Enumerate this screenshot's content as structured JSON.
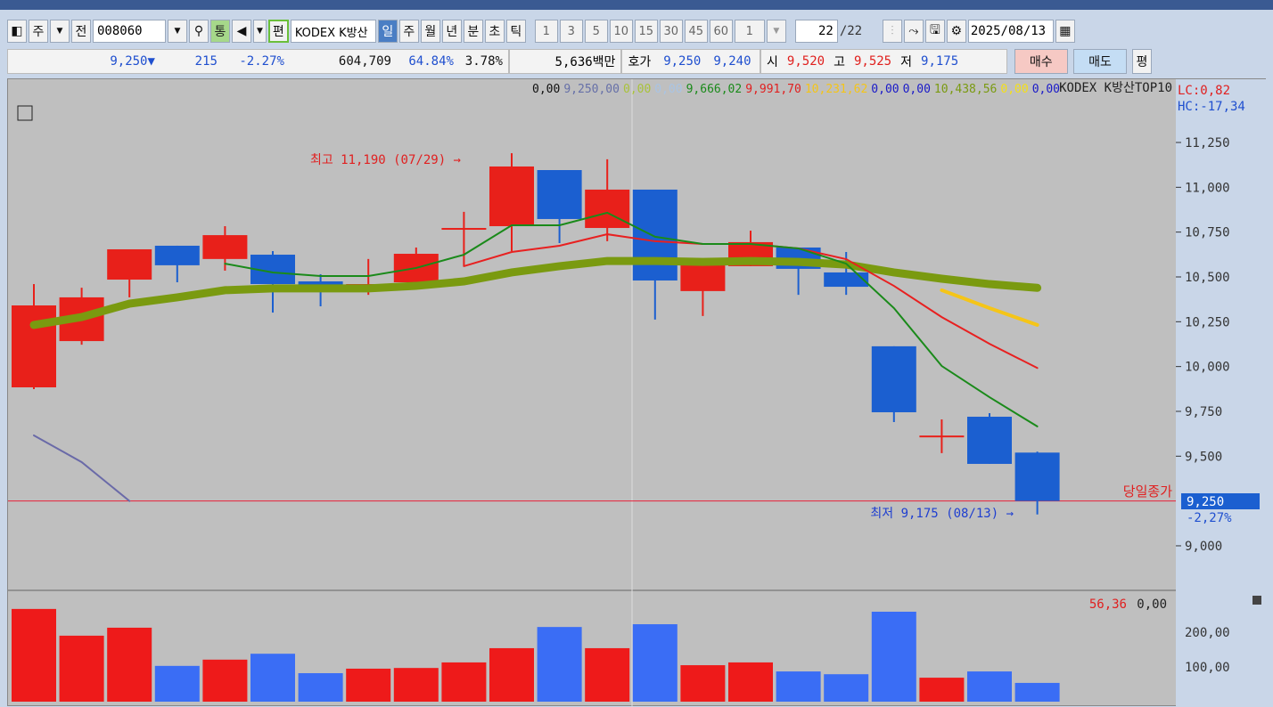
{
  "toolbar": {
    "market": "주",
    "prev": "전",
    "code": "008060",
    "tong": "통",
    "pyeon": "편",
    "name": "KODEX K방산",
    "periods": [
      "일",
      "주",
      "월",
      "년",
      "분",
      "초",
      "틱"
    ],
    "active_period": "일",
    "intervals": [
      "1",
      "3",
      "5",
      "10",
      "15",
      "30",
      "45",
      "60"
    ],
    "count_select": "1",
    "count": "22",
    "total": "/22",
    "date": "2025/08/13"
  },
  "info": {
    "price": "9,250",
    "arrow": "▼",
    "change": "215",
    "change_pct": "-2.27%",
    "volume": "604,709",
    "vol_ratio": "64.84%",
    "turnover": "3.78%",
    "amount": "5,636백만",
    "hoga_label": "호가",
    "ask": "9,250",
    "bid": "9,240",
    "open_label": "시",
    "open": "9,520",
    "high_label": "고",
    "high": "9,525",
    "low_label": "저",
    "low": "9,175",
    "buy": "매수",
    "sell": "매도",
    "avg": "평"
  },
  "legend": {
    "v1": "0,00",
    "v2": "9,250,00",
    "v3": "0,00",
    "v4": "0,00",
    "v5": "9,666,02",
    "v6": "9,991,70",
    "v7": "10,231,62",
    "v8": "0,00",
    "v9": "0,00",
    "v10": "10,438,56",
    "v11": "0,00",
    "v12": "0,00",
    "title": "KODEX K방산TOP10",
    "lc": "LC:0,82",
    "hc": "HC:-17,34"
  },
  "annotations": {
    "high": "최고 11,190 (07/29) →",
    "low": "최저 9,175 (08/13) →",
    "close_label": "당일종가",
    "cur_price": "9,250",
    "cur_pct": "-2,27%"
  },
  "volume_legend": {
    "v1": "56,36",
    "v2": "0,00"
  },
  "colors": {
    "up": "#e8201a",
    "down": "#1b5fd0",
    "ma5": "#1a8a1a",
    "ma10": "#e82020",
    "ma20": "#f5c518",
    "ma60": "#7a9a10",
    "vol_up": "#ee1a1a",
    "vol_down": "#3a6df5"
  },
  "chart_data": {
    "type": "candlestick",
    "price_ticks": [
      "11,250",
      "11,000",
      "10,750",
      "10,500",
      "10,250",
      "10,000",
      "9,750",
      "9,500",
      "9,000"
    ],
    "price_tick_values": [
      11250,
      11000,
      10750,
      10500,
      10250,
      10000,
      9750,
      9500,
      9000
    ],
    "ylim": [
      8800,
      11400
    ],
    "ohlc": [
      [
        9884,
        10460,
        9874,
        10341
      ],
      [
        10142,
        10440,
        10122,
        10386
      ],
      [
        10485,
        10654,
        10386,
        10654
      ],
      [
        10674,
        10674,
        10470,
        10565
      ],
      [
        10600,
        10783,
        10535,
        10733
      ],
      [
        10624,
        10644,
        10301,
        10460
      ],
      [
        10475,
        10515,
        10336,
        10450
      ],
      [
        10450,
        10600,
        10400,
        10460
      ],
      [
        10470,
        10664,
        10460,
        10629
      ],
      [
        10768,
        10863,
        10560,
        10773
      ],
      [
        10783,
        11190,
        10644,
        11116
      ],
      [
        11096,
        11096,
        10689,
        10823
      ],
      [
        10773,
        11156,
        10699,
        10987
      ],
      [
        10987,
        10987,
        10262,
        10480
      ],
      [
        10421,
        10570,
        10282,
        10570
      ],
      [
        10560,
        10758,
        10560,
        10694
      ],
      [
        10664,
        10664,
        10400,
        10545
      ],
      [
        10525,
        10639,
        10400,
        10445
      ],
      [
        10113,
        10113,
        9690,
        9745
      ],
      [
        9610,
        9705,
        9517,
        9615
      ],
      [
        9720,
        9740,
        9457,
        9457
      ],
      [
        9520,
        9525,
        9175,
        9250
      ]
    ],
    "ma5": {
      "start": 4,
      "values": [
        10574,
        10525,
        10505,
        10505,
        10550,
        10624,
        10788,
        10788,
        10858,
        10724,
        10684,
        10684,
        10659,
        10574,
        10326,
        10003,
        9829,
        9666
      ]
    },
    "ma10": {
      "start": 9,
      "values": [
        10560,
        10639,
        10674,
        10738,
        10699,
        10684,
        10684,
        10659,
        10599,
        10450,
        10276,
        10127,
        9992
      ]
    },
    "ma20": {
      "start": 19,
      "values": [
        10426,
        10326,
        10232
      ]
    },
    "ma60": {
      "start": 0,
      "values": [
        10232,
        10276,
        10351,
        10386,
        10426,
        10436,
        10436,
        10436,
        10450,
        10475,
        10525,
        10560,
        10589,
        10589,
        10584,
        10589,
        10584,
        10569,
        10525,
        10490,
        10460,
        10439
      ]
    },
    "other": {
      "start": 0,
      "values": [
        9616,
        9467,
        9250
      ]
    },
    "volume_ticks": [
      "200,00",
      "100,00"
    ],
    "volume_tick_values": [
      200,
      100
    ],
    "volume": [
      267,
      190,
      213,
      103,
      121,
      138,
      82,
      95,
      97,
      113,
      154,
      215,
      154,
      223,
      105,
      113,
      87,
      79,
      259,
      69,
      87,
      54
    ]
  }
}
